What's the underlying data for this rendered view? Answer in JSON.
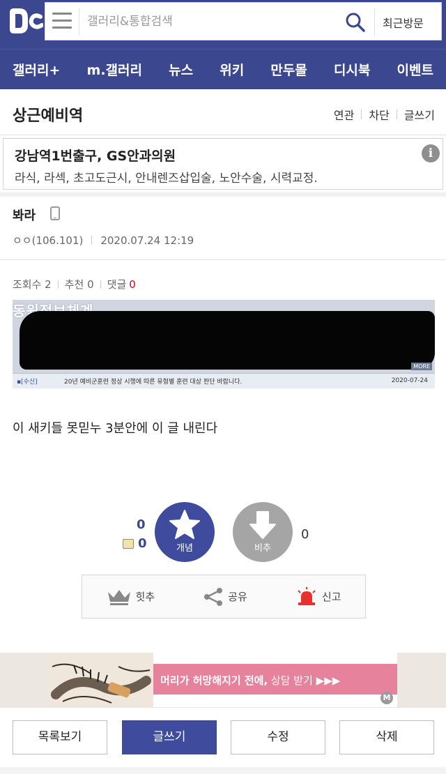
{
  "header": {
    "search_placeholder": "갤러리&통합검색",
    "recent_label": "최근방문"
  },
  "nav": {
    "items": [
      "갤러리+",
      "m.갤러리",
      "뉴스",
      "위키",
      "만두몰",
      "디시북",
      "이벤트"
    ]
  },
  "gallery": {
    "title": "상근예비역",
    "links": [
      "연관",
      "차단",
      "글쓰기"
    ]
  },
  "ad": {
    "title": "강남역1번출구, GS안과의원",
    "description": "라식, 라섹, 초고도근시, 안내렌즈삽입술, 노안수술, 시력교정."
  },
  "post": {
    "title": "봐라",
    "author": "ㅇㅇ(106.101)",
    "datetime": "2020.07.24 12:19",
    "views_label": "조회수 2",
    "recommend_label": "추천 0",
    "comments_label": "댓글",
    "comments_count": "0",
    "body": "이 새키들 못믿누 3분안에 이 글 내린다",
    "image": {
      "header_text": "동원정보체계",
      "tag": "▪[수신]",
      "caption": "20년 예비군훈련 정상 시행에 따른 유형별 훈련 대상 판단 바랍니다.",
      "date": "2020-07-24",
      "more": "MORE"
    }
  },
  "vote": {
    "up_count": "0",
    "fix_count": "0",
    "up_label": "개념",
    "down_label": "비추",
    "down_count": "0"
  },
  "actions": {
    "hit": "힛추",
    "share": "공유",
    "report": "신고"
  },
  "banner": {
    "text_bold": "머리가 허망해지기 전에,",
    "text_light": " 상담 받기 ▶▶▶",
    "badge": "M"
  },
  "buttons": {
    "list": "목록보기",
    "write": "글쓰기",
    "edit": "수정",
    "delete": "삭제"
  },
  "colors": {
    "brand": "#3b4890",
    "vote_up": "#3f4b9c",
    "vote_down": "#a5a5a5",
    "comment_count": "#d0021b",
    "banner": "#e6829b"
  }
}
